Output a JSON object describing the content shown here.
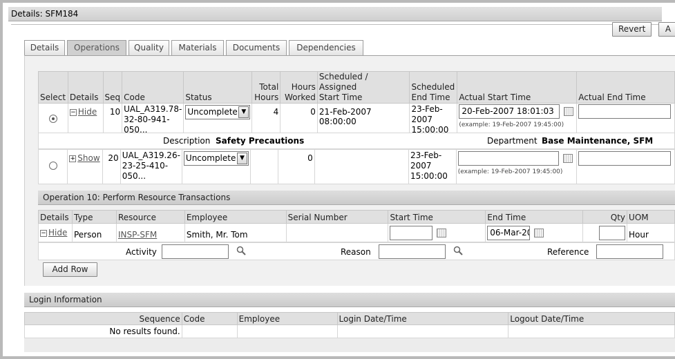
{
  "header": {
    "title": "Details: SFM184"
  },
  "buttons": {
    "revert": "Revert",
    "apply_partial": "A"
  },
  "tabs": [
    {
      "label": "Details",
      "active": false
    },
    {
      "label": "Operations",
      "active": true
    },
    {
      "label": "Quality",
      "active": false
    },
    {
      "label": "Materials",
      "active": false
    },
    {
      "label": "Documents",
      "active": false
    },
    {
      "label": "Dependencies",
      "active": false
    }
  ],
  "operations": {
    "columns": {
      "select": "Select",
      "details": "Details",
      "seq": "Seq",
      "code": "Code",
      "status": "Status",
      "total_hours_1": "Total",
      "total_hours_2": "Hours",
      "hours_worked_1": "Hours",
      "hours_worked_2": "Worked",
      "sched_start_1": "Scheduled / Assigned",
      "sched_start_2": "Start Time",
      "sched_end_1": "Scheduled",
      "sched_end_2": "End Time",
      "actual_start": "Actual Start Time",
      "actual_end": "Actual End Time"
    },
    "rows": [
      {
        "toggle": "Hide",
        "seq": "10",
        "code_1": "UAL_A319.78-",
        "code_2": "32-80-941-",
        "code_3": "050...",
        "status": "Uncomplete",
        "total_hours": "4",
        "hours_worked": "0",
        "sched_start": "21-Feb-2007 08:00:00",
        "sched_end_1": "23-Feb-",
        "sched_end_2": "2007",
        "sched_end_3": "15:00:00",
        "actual_start": "20-Feb-2007 18:01:03",
        "actual_start_hint": "(example: 19-Feb-2007 19:45:00)"
      },
      {
        "toggle": "Show",
        "seq": "20",
        "code_1": "UAL_A319.26-",
        "code_2": "23-25-410-",
        "code_3": "050...",
        "status": "Uncomplete",
        "total_hours": "",
        "hours_worked": "0",
        "sched_start": "",
        "sched_end_1": "23-Feb-",
        "sched_end_2": "2007",
        "sched_end_3": "15:00:00",
        "actual_start": "",
        "actual_start_hint": "(example: 19-Feb-2007 19:45:00)"
      }
    ],
    "detail": {
      "description_label": "Description",
      "description_value": "Safety Precautions",
      "department_label": "Department",
      "department_value": "Base Maintenance, SFM"
    }
  },
  "resource_section": {
    "title": "Operation 10: Perform Resource Transactions",
    "columns": {
      "details": "Details",
      "type": "Type",
      "resource": "Resource",
      "employee": "Employee",
      "serial": "Serial Number",
      "start": "Start Time",
      "end": "End Time",
      "qty": "Qty",
      "uom": "UOM"
    },
    "row": {
      "toggle": "Hide",
      "type": "Person",
      "resource": "INSP-SFM",
      "employee": "Smith, Mr. Tom",
      "start": "",
      "end": "06-Mar-20",
      "qty": "",
      "uom": "Hour"
    },
    "detail": {
      "activity_label": "Activity",
      "reason_label": "Reason",
      "reference_label": "Reference"
    },
    "add_row": "Add Row"
  },
  "login": {
    "title": "Login Information",
    "columns": {
      "sequence": "Sequence",
      "code": "Code",
      "employee": "Employee",
      "login": "Login Date/Time",
      "logout": "Logout Date/Time"
    },
    "empty": "No results found."
  }
}
